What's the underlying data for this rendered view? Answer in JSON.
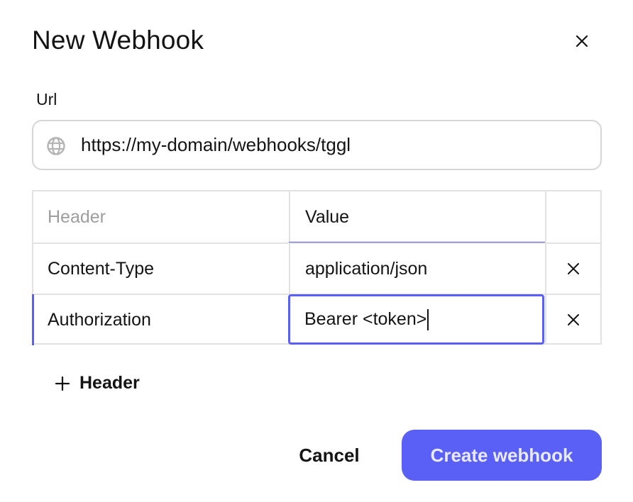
{
  "dialog": {
    "title": "New Webhook",
    "close_icon": "close-icon"
  },
  "url": {
    "label": "Url",
    "value": "https://my-domain/webhooks/tggl",
    "icon": "globe-icon"
  },
  "headers_table": {
    "columns": {
      "name_placeholder": "Header",
      "value_label": "Value"
    },
    "rows": [
      {
        "name": "Content-Type",
        "value": "application/json",
        "delete_icon": "close-icon"
      },
      {
        "name": "Authorization",
        "value": "Bearer <token>",
        "delete_icon": "close-icon",
        "focused": true
      }
    ]
  },
  "add_header": {
    "icon": "plus-icon",
    "label": "Header"
  },
  "footer": {
    "cancel_label": "Cancel",
    "create_label": "Create webhook"
  },
  "colors": {
    "accent": "#5a5ff5",
    "border": "#e2e2e2",
    "text": "#141414",
    "placeholder": "#9e9e9e"
  }
}
